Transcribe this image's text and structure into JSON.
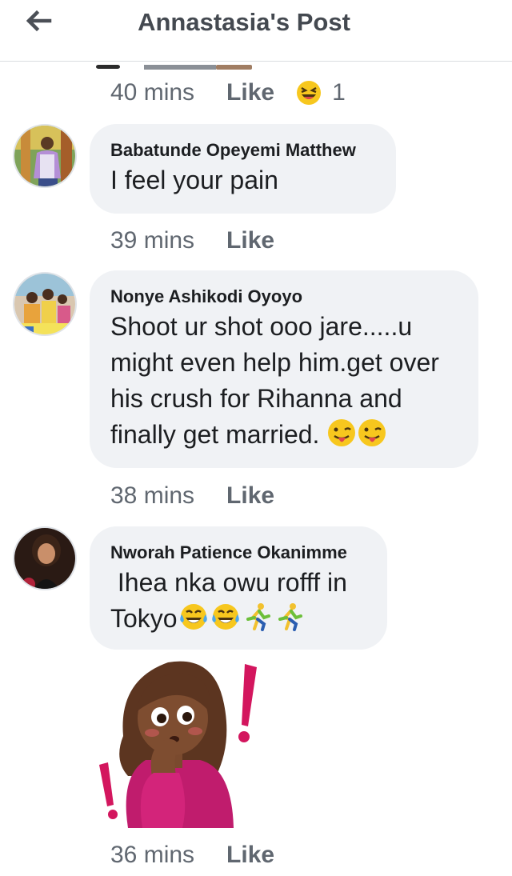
{
  "header": {
    "title": "Annastasia's Post",
    "back_icon": "back-arrow-icon"
  },
  "comments": [
    {
      "time": "40 mins",
      "like": "Like",
      "reaction_count": "1",
      "reaction_icon": "laughing-squint-emoji-icon"
    },
    {
      "author": "Babatunde Opeyemi Matthew",
      "text": "I feel your pain",
      "time": "39 mins",
      "like": "Like"
    },
    {
      "author": "Nonye Ashikodi Oyoyo",
      "text_lines": [
        "Shoot ur shot ooo jare.....u",
        "might even help him.get over",
        "his crush for Rihanna and",
        "finally get married."
      ],
      "time": "38 mins",
      "like": "Like"
    },
    {
      "author": "Nworah Patience Okanimme",
      "text_lines": [
        " Ihea nka owu rofff in",
        "Tokyo"
      ],
      "time": "36 mins",
      "like": "Like"
    }
  ],
  "colors": {
    "bubble": "#f0f2f5",
    "meta": "#606770",
    "header_title": "#444950"
  }
}
